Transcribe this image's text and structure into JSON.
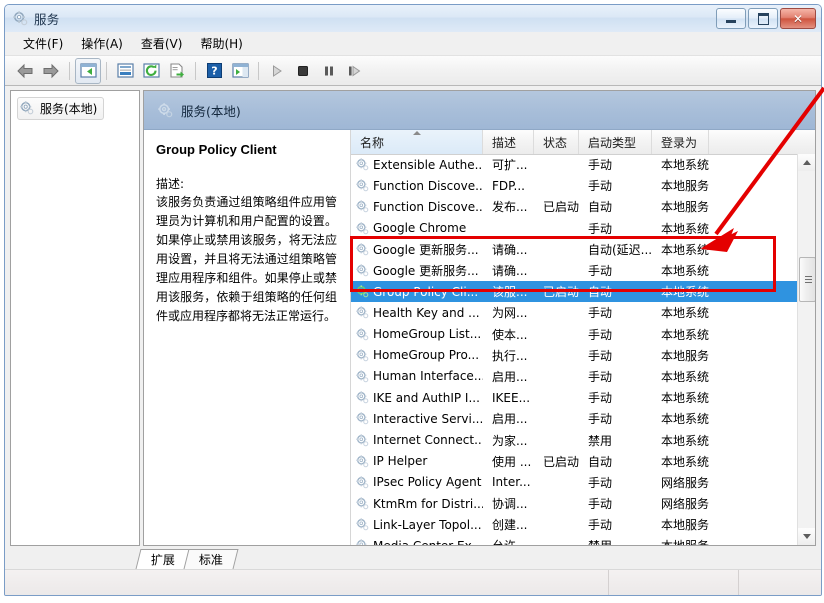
{
  "window": {
    "title": "服务",
    "icon": "services-gear-icon",
    "buttons": {
      "minimize": "最小化",
      "maximize": "最大化",
      "close": "关闭"
    }
  },
  "menu": {
    "items": [
      {
        "label": "文件(F)",
        "name": "menu-file"
      },
      {
        "label": "操作(A)",
        "name": "menu-action"
      },
      {
        "label": "查看(V)",
        "name": "menu-view"
      },
      {
        "label": "帮助(H)",
        "name": "menu-help"
      }
    ]
  },
  "toolbar": {
    "items": [
      {
        "name": "back-icon",
        "title": "后退"
      },
      {
        "name": "forward-icon",
        "title": "前进"
      },
      {
        "name": "show-hide-console-tree-icon",
        "title": "显示/隐藏控制台树"
      },
      {
        "name": "properties-icon",
        "title": "属性"
      },
      {
        "name": "refresh-icon",
        "title": "刷新"
      },
      {
        "name": "export-list-icon",
        "title": "导出列表"
      },
      {
        "name": "help-icon",
        "title": "帮助"
      },
      {
        "name": "show-action-pane-icon",
        "title": "显示操作窗格"
      },
      {
        "name": "start-service-icon",
        "title": "启动服务"
      },
      {
        "name": "stop-service-icon",
        "title": "停止服务"
      },
      {
        "name": "pause-service-icon",
        "title": "暂停服务"
      },
      {
        "name": "restart-service-icon",
        "title": "重启动服务"
      }
    ]
  },
  "tree": {
    "root": {
      "label": "服务(本地)",
      "icon": "services-gear-icon"
    }
  },
  "detail": {
    "header": "服务(本地)",
    "header_icon": "services-gear-icon",
    "service_name": "Group Policy Client",
    "description_label": "描述:",
    "description": "该服务负责通过组策略组件应用管理员为计算机和用户配置的设置。如果停止或禁用该服务，将无法应用设置，并且将无法通过组策略管理应用程序和组件。如果停止或禁用该服务，依赖于组策略的任何组件或应用程序都将无法正常运行。"
  },
  "list": {
    "columns": [
      {
        "label": "名称",
        "name": "column-name",
        "width": 132,
        "sorted": true
      },
      {
        "label": "描述",
        "name": "column-description",
        "width": 51,
        "sorted": false
      },
      {
        "label": "状态",
        "name": "column-status",
        "width": 45,
        "sorted": false
      },
      {
        "label": "启动类型",
        "name": "column-startup-type",
        "width": 73,
        "sorted": false
      },
      {
        "label": "登录为",
        "name": "column-log-on-as",
        "width": 57,
        "sorted": false
      },
      {
        "label": "",
        "name": "column-filler",
        "width": 80,
        "sorted": false
      }
    ],
    "rows": [
      {
        "name": "Extensible Authe...",
        "description": "可扩...",
        "status": "",
        "startup": "手动",
        "logon": "本地系统",
        "selected": false
      },
      {
        "name": "Function Discove...",
        "description": "FDP...",
        "status": "",
        "startup": "手动",
        "logon": "本地服务",
        "selected": false
      },
      {
        "name": "Function Discove...",
        "description": "发布...",
        "status": "已启动",
        "startup": "自动",
        "logon": "本地服务",
        "selected": false
      },
      {
        "name": "Google Chrome",
        "description": "",
        "status": "",
        "startup": "手动",
        "logon": "本地系统",
        "selected": false
      },
      {
        "name": "Google 更新服务...",
        "description": "请确...",
        "status": "",
        "startup": "自动(延迟...",
        "logon": "本地系统",
        "selected": false
      },
      {
        "name": "Google 更新服务...",
        "description": "请确...",
        "status": "",
        "startup": "手动",
        "logon": "本地系统",
        "selected": false
      },
      {
        "name": "Group Policy Cli...",
        "description": "该服...",
        "status": "已启动",
        "startup": "自动",
        "logon": "本地系统",
        "selected": true
      },
      {
        "name": "Health Key and ...",
        "description": "为网...",
        "status": "",
        "startup": "手动",
        "logon": "本地系统",
        "selected": false
      },
      {
        "name": "HomeGroup List...",
        "description": "使本...",
        "status": "",
        "startup": "手动",
        "logon": "本地系统",
        "selected": false
      },
      {
        "name": "HomeGroup Pro...",
        "description": "执行...",
        "status": "",
        "startup": "手动",
        "logon": "本地服务",
        "selected": false
      },
      {
        "name": "Human Interface...",
        "description": "启用...",
        "status": "",
        "startup": "手动",
        "logon": "本地系统",
        "selected": false
      },
      {
        "name": "IKE and AuthIP I...",
        "description": "IKEE...",
        "status": "",
        "startup": "手动",
        "logon": "本地系统",
        "selected": false
      },
      {
        "name": "Interactive Servi...",
        "description": "启用...",
        "status": "",
        "startup": "手动",
        "logon": "本地系统",
        "selected": false
      },
      {
        "name": "Internet Connect...",
        "description": "为家...",
        "status": "",
        "startup": "禁用",
        "logon": "本地系统",
        "selected": false
      },
      {
        "name": "IP Helper",
        "description": "使用 ...",
        "status": "已启动",
        "startup": "自动",
        "logon": "本地系统",
        "selected": false
      },
      {
        "name": "IPsec Policy Agent",
        "description": "Inter...",
        "status": "",
        "startup": "手动",
        "logon": "网络服务",
        "selected": false
      },
      {
        "name": "KtmRm for Distri...",
        "description": "协调...",
        "status": "",
        "startup": "手动",
        "logon": "网络服务",
        "selected": false
      },
      {
        "name": "Link-Layer Topol...",
        "description": "创建...",
        "status": "",
        "startup": "手动",
        "logon": "本地服务",
        "selected": false
      },
      {
        "name": "Media Center Ex...",
        "description": "允许 ...",
        "status": "",
        "startup": "禁用",
        "logon": "本地服务",
        "selected": false
      }
    ],
    "scrollbar": {
      "up": "向上滚动",
      "down": "向下滚动",
      "thumb": "滚动条滑块"
    }
  },
  "tabs": [
    {
      "label": "扩展",
      "name": "tab-extended",
      "active": false
    },
    {
      "label": "标准",
      "name": "tab-standard",
      "active": true
    }
  ],
  "annotation": {
    "highlight_color": "#e40000",
    "arrow_color": "#e40000",
    "target": "Google 更新服务"
  }
}
